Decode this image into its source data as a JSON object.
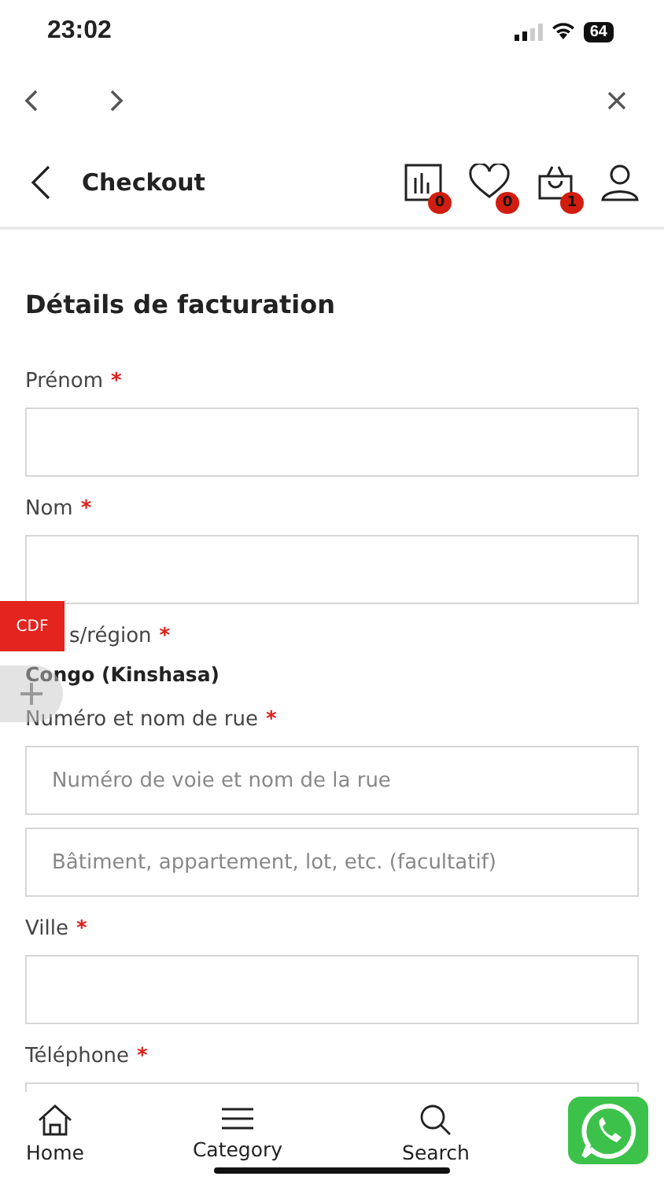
{
  "status_bar": {
    "time": "23:02",
    "battery": "64"
  },
  "header": {
    "title": "Checkout",
    "badges": [
      {
        "kind": "compare",
        "count": "0"
      },
      {
        "kind": "wishlist",
        "count": "0"
      },
      {
        "kind": "cart",
        "count": "1"
      },
      {
        "kind": "account"
      }
    ]
  },
  "form": {
    "title": "Détails de facturation",
    "fields": [
      {
        "kind": "input",
        "label": "Prénom",
        "mark": "*"
      },
      {
        "kind": "input",
        "label": "Nom",
        "mark": "*"
      },
      {
        "kind": "static",
        "label": "s/région",
        "mark": "*",
        "value": "Congo (Kinshasa)"
      },
      {
        "kind": "input",
        "label": "Numéro et nom de rue",
        "mark": "*",
        "placeholder": "Numéro de voie et nom de la rue"
      },
      {
        "kind": "input",
        "placeholder": "Bâtiment, appartement, lot, etc. (facultatif)"
      },
      {
        "kind": "input",
        "label": "Ville",
        "mark": "*"
      },
      {
        "kind": "input",
        "label": "Téléphone",
        "mark": "*"
      }
    ]
  },
  "currency_badge": "CDF",
  "tab_bar": [
    {
      "kind": "home",
      "label": "Home"
    },
    {
      "kind": "category",
      "label": "Category"
    },
    {
      "kind": "search",
      "label": "Search"
    }
  ]
}
